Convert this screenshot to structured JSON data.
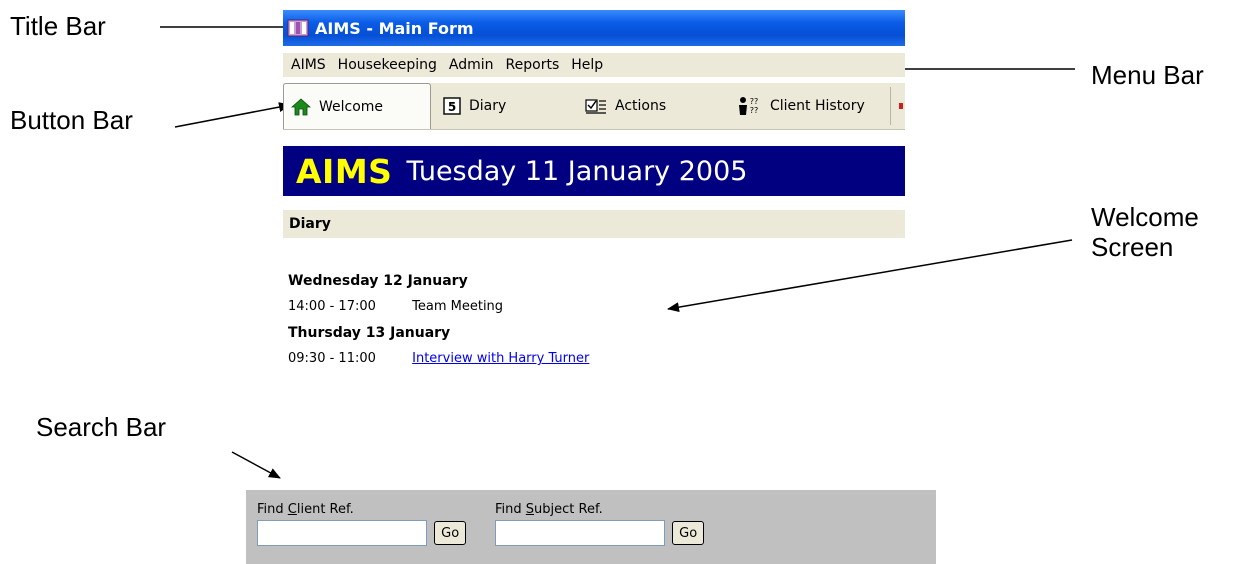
{
  "annotations": {
    "title_bar": "Title Bar",
    "button_bar": "Button Bar",
    "menu_bar": "Menu Bar",
    "welcome_screen_line1": "Welcome",
    "welcome_screen_line2": "Screen",
    "search_bar": "Search Bar"
  },
  "window": {
    "title": "AIMS - Main Form",
    "icon": "app-icon"
  },
  "menu": {
    "items": [
      "AIMS",
      "Housekeeping",
      "Admin",
      "Reports",
      "Help"
    ]
  },
  "toolbar": {
    "buttons": [
      {
        "label": "Welcome",
        "icon": "home-icon"
      },
      {
        "label": "Diary",
        "icon": "calendar-icon"
      },
      {
        "label": "Actions",
        "icon": "actions-icon"
      },
      {
        "label": "Client History",
        "icon": "client-history-icon"
      }
    ]
  },
  "banner": {
    "brand": "AIMS",
    "date": "Tuesday 11 January 2005"
  },
  "diary": {
    "header": "Diary",
    "days": [
      {
        "day": "Wednesday 12 January",
        "time": "14:00 - 17:00",
        "text": "Team Meeting",
        "is_link": false
      },
      {
        "day": "Thursday 13 January",
        "time": "09:30 - 11:00",
        "text": "Interview with Harry Turner",
        "is_link": true
      }
    ]
  },
  "search": {
    "client_label_prefix": "Find ",
    "client_label_accel": "C",
    "client_label_rest": "lient Ref.",
    "client_value": "",
    "client_go": "Go",
    "subject_label_prefix": "Find ",
    "subject_label_accel": "S",
    "subject_label_rest": "ubject Ref.",
    "subject_value": "",
    "subject_go": "Go"
  },
  "colors": {
    "banner_bg": "#000080",
    "brand_text": "#ffff00",
    "xp_face": "#ece9d8",
    "search_bg": "#c0c0c0"
  }
}
